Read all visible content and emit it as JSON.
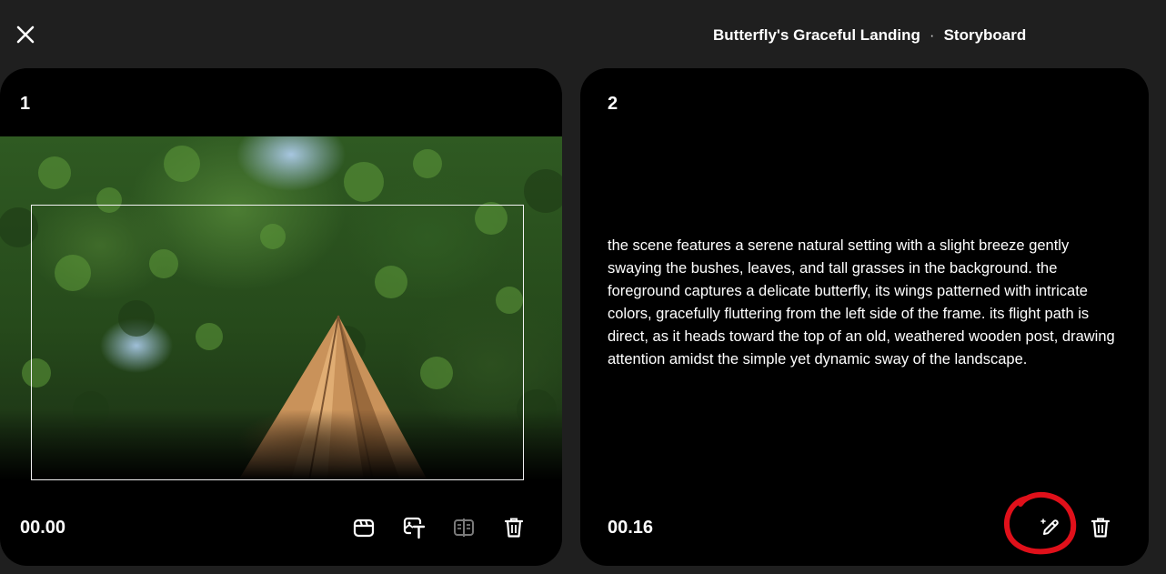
{
  "header": {
    "title": "Butterfly's Graceful Landing",
    "separator": "·",
    "section": "Storyboard",
    "close_icon": "close-icon"
  },
  "cards": [
    {
      "number": "1",
      "timecode": "00.00",
      "thumbnail": "scene-thumbnail",
      "tools": [
        "clapperboard-icon",
        "text-to-image-icon",
        "split-compare-icon",
        "trash-icon"
      ]
    },
    {
      "number": "2",
      "timecode": "00.16",
      "description": "the scene features a serene natural setting with a slight breeze gently swaying the bushes, leaves, and tall grasses in the background. the foreground captures a delicate butterfly, its wings patterned with intricate colors, gracefully fluttering from the left side of the frame. its flight path is direct, as it heads toward the top of an old, weathered wooden post, drawing attention amidst the simple yet dynamic sway of the landscape.",
      "tools": [
        "magic-edit-icon",
        "trash-icon"
      ]
    }
  ],
  "colors": {
    "background": "#1f1f1f",
    "card": "#000000",
    "annotation": "#e0101a",
    "disabled_icon": "#7a7a7a"
  }
}
